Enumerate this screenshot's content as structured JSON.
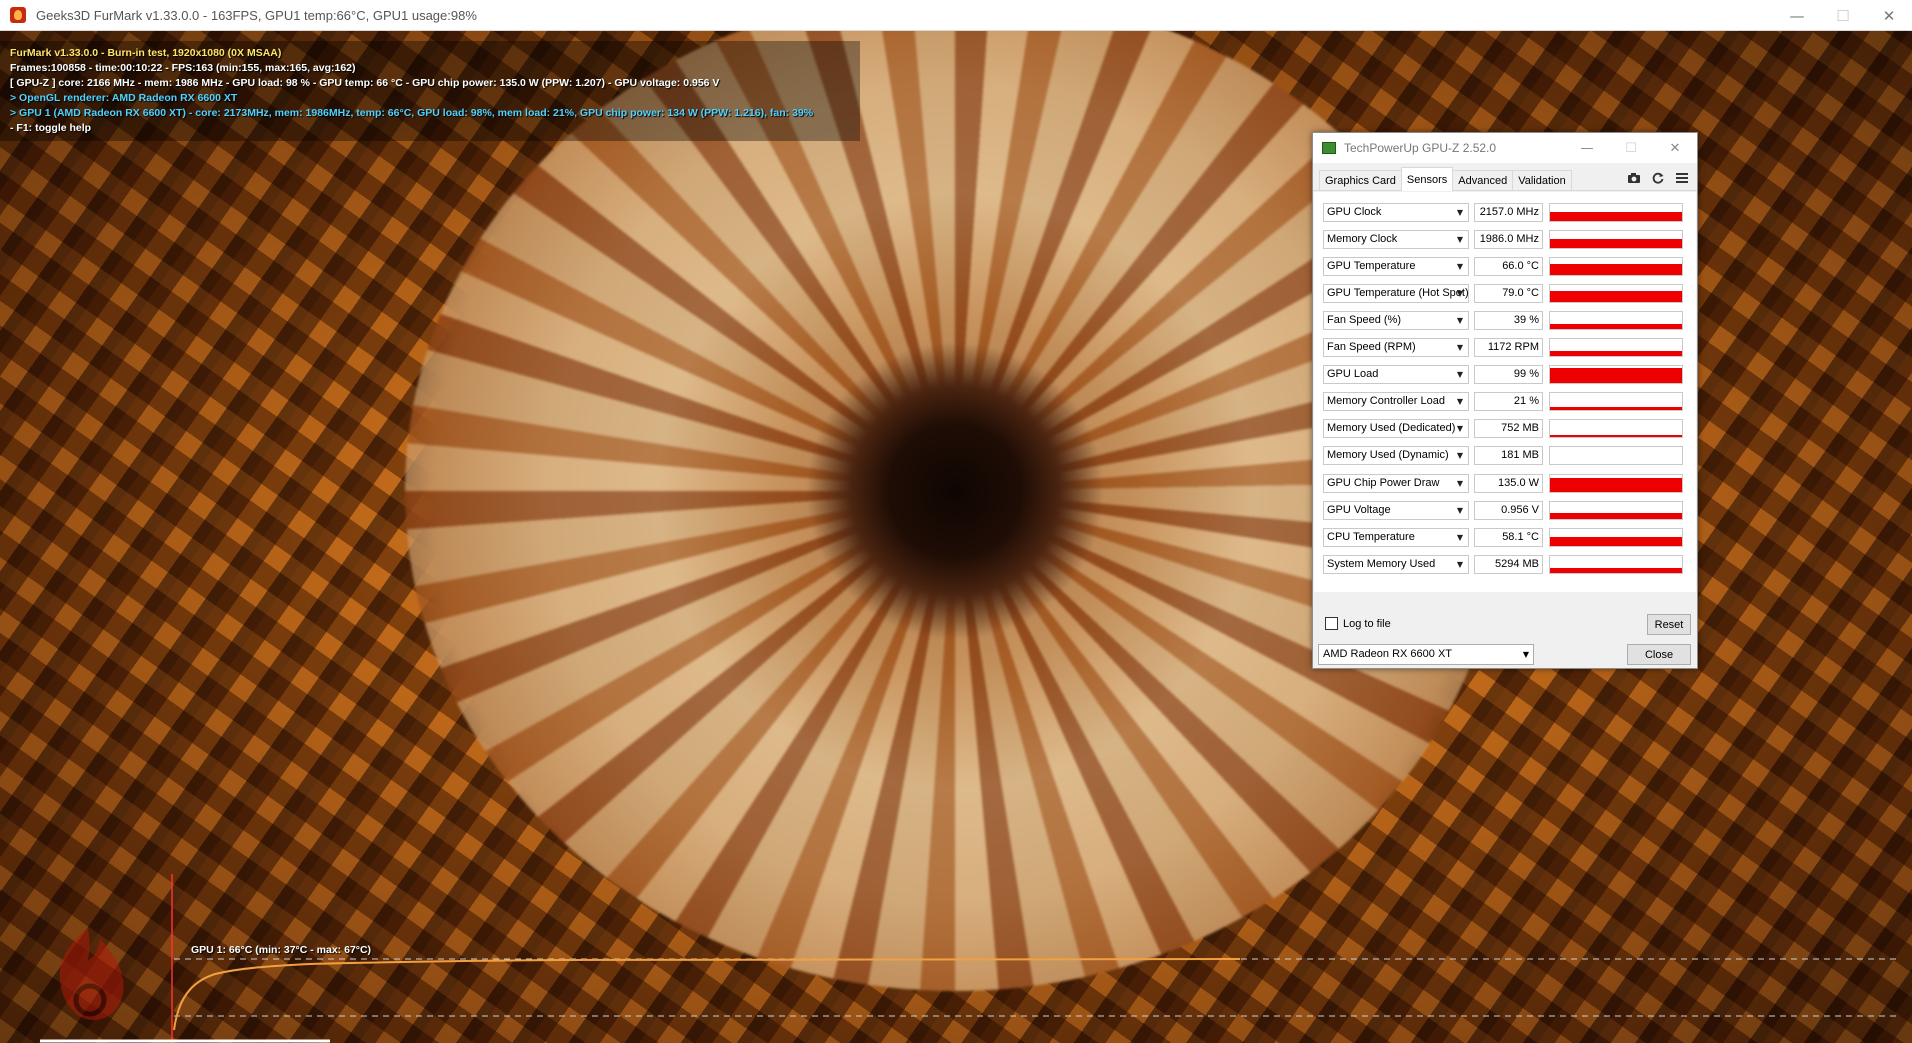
{
  "furmark": {
    "window_title": "Geeks3D FurMark v1.33.0.0 - 163FPS, GPU1 temp:66°C, GPU1 usage:98%",
    "controls": {
      "minimize": "—",
      "maximize": "☐",
      "close": "✕"
    },
    "osd": {
      "line1": "FurMark v1.33.0.0 - Burn-in test, 1920x1080 (0X MSAA)",
      "line2": "Frames:100858 - time:00:10:22 - FPS:163 (min:155, max:165, avg:162)",
      "line3": "[ GPU-Z ] core: 2166 MHz - mem: 1986 MHz - GPU load: 98 % - GPU temp: 66 °C - GPU chip power: 135.0 W (PPW: 1.207) - GPU voltage: 0.956 V",
      "line4": "> OpenGL renderer: AMD Radeon RX 6600 XT",
      "line5": "> GPU 1 (AMD Radeon RX 6600 XT) - core: 2173MHz, mem: 1986MHz, temp: 66°C, GPU load: 98%, mem load: 21%, GPU chip power: 134 W (PPW: 1.216), fan: 39%",
      "line6": "- F1: toggle help"
    },
    "graph_label": "GPU 1: 66°C (min: 37°C - max: 67°C)",
    "colors": {
      "osd_yellow": "#ffe567",
      "osd_cyan": "#4fd2ff",
      "graph_line": "#f0a040"
    }
  },
  "gpuz": {
    "title": "TechPowerUp GPU-Z 2.52.0",
    "controls": {
      "minimize": "—",
      "maximize": "☐",
      "close": "✕"
    },
    "tabs": [
      "Graphics Card",
      "Sensors",
      "Advanced",
      "Validation"
    ],
    "active_tab": "Sensors",
    "tool_icons": [
      "camera-icon",
      "refresh-icon",
      "menu-icon"
    ],
    "sensors": [
      {
        "name": "GPU Clock",
        "value": "2157.0 MHz",
        "level": 0.55
      },
      {
        "name": "Memory Clock",
        "value": "1986.0 MHz",
        "level": 0.55
      },
      {
        "name": "GPU Temperature",
        "value": "66.0 °C",
        "level": 0.62
      },
      {
        "name": "GPU Temperature (Hot Spot)",
        "value": "79.0 °C",
        "level": 0.66
      },
      {
        "name": "Fan Speed (%)",
        "value": "39 %",
        "level": 0.3
      },
      {
        "name": "Fan Speed (RPM)",
        "value": "1172 RPM",
        "level": 0.3
      },
      {
        "name": "GPU Load",
        "value": "99 %",
        "level": 0.9
      },
      {
        "name": "Memory Controller Load",
        "value": "21 %",
        "level": 0.18
      },
      {
        "name": "Memory Used (Dedicated)",
        "value": "752 MB",
        "level": 0.1
      },
      {
        "name": "Memory Used (Dynamic)",
        "value": "181 MB",
        "level": 0.0
      },
      {
        "name": "GPU Chip Power Draw",
        "value": "135.0 W",
        "level": 0.8
      },
      {
        "name": "GPU Voltage",
        "value": "0.956 V",
        "level": 0.35
      },
      {
        "name": "CPU Temperature",
        "value": "58.1 °C",
        "level": 0.5
      },
      {
        "name": "System Memory Used",
        "value": "5294 MB",
        "level": 0.3
      }
    ],
    "log_to_file": "Log to file",
    "reset": "Reset",
    "gpu_select": "AMD Radeon RX 6600 XT",
    "close": "Close",
    "colors": {
      "sensor_bar": "#ee0000"
    }
  }
}
